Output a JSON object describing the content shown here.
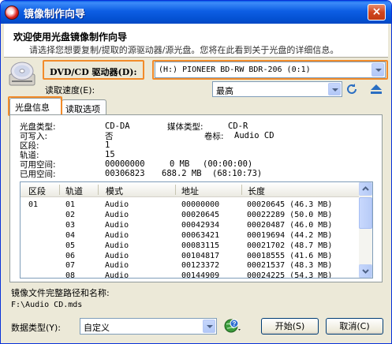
{
  "window": {
    "title": "镜像制作向导",
    "close_glyph": "×"
  },
  "header": {
    "title": "欢迎使用光盘镜像制作向导",
    "subtitle": "请选择您想要复制/提取的源驱动器/源光盘。您将在此看到关于光盘的详细信息。"
  },
  "drive": {
    "label": "DVD/CD 驱动器(D):",
    "selected": "(H:) PIONEER BD-RW   BDR-206 (0:1)"
  },
  "read_speed": {
    "label": "读取速度(E):",
    "selected": "最高"
  },
  "tabs": [
    {
      "label": "光盘信息"
    },
    {
      "label": "读取选项"
    }
  ],
  "disc_info": {
    "disc_type_label": "光盘类型:",
    "disc_type_value": "CD-DA",
    "media_type_label": "媒体类型:",
    "media_type_value": "CD-R",
    "writable_label": "可写入:",
    "writable_value": "否",
    "volume_label": "卷标:",
    "volume_value": "Audio CD",
    "sessions_label": "区段:",
    "sessions_value": "1",
    "tracks_label": "轨道:",
    "tracks_value": "15",
    "free_label": "可用空间:",
    "free_sectors": "00000000",
    "free_size": "0 MB",
    "free_time": "(00:00:00)",
    "used_label": "已用空间:",
    "used_sectors": "00306823",
    "used_size": "688.2 MB",
    "used_time": "(68:10:73)"
  },
  "track_table": {
    "columns": [
      "区段",
      "轨道",
      "模式",
      "地址",
      "长度"
    ],
    "rows": [
      {
        "session": "01",
        "track": "01",
        "mode": "Audio",
        "address": "00000000",
        "length": "00020645 (46.3 MB)"
      },
      {
        "session": "",
        "track": "02",
        "mode": "Audio",
        "address": "00020645",
        "length": "00022289 (50.0 MB)"
      },
      {
        "session": "",
        "track": "03",
        "mode": "Audio",
        "address": "00042934",
        "length": "00020487 (46.0 MB)"
      },
      {
        "session": "",
        "track": "04",
        "mode": "Audio",
        "address": "00063421",
        "length": "00019694 (44.2 MB)"
      },
      {
        "session": "",
        "track": "05",
        "mode": "Audio",
        "address": "00083115",
        "length": "00021702 (48.7 MB)"
      },
      {
        "session": "",
        "track": "06",
        "mode": "Audio",
        "address": "00104817",
        "length": "00018555 (41.6 MB)"
      },
      {
        "session": "",
        "track": "07",
        "mode": "Audio",
        "address": "00123372",
        "length": "00021537 (48.3 MB)"
      },
      {
        "session": "",
        "track": "08",
        "mode": "Audio",
        "address": "00144909",
        "length": "00024225 (54.3 MB)"
      }
    ]
  },
  "image_path": {
    "label": "镜像文件完整路径和名称:",
    "value": "F:\\Audio CD.mds"
  },
  "data_type": {
    "label": "数据类型(Y):",
    "selected": "自定义"
  },
  "buttons": {
    "start": "开始(S)",
    "cancel": "取消(C)"
  },
  "icons": {
    "app": "disc-app-icon",
    "disc": "optical-disc-icon",
    "refresh": "refresh-icon",
    "eject": "eject-icon",
    "help": "help-globe-icon"
  },
  "colors": {
    "titlebar": "#0a5ee8",
    "highlight": "#f28b2a",
    "dialog_bg": "#ece9d8"
  }
}
